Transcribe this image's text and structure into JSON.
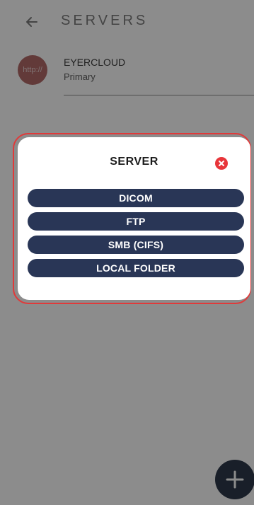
{
  "app_bar": {
    "title": "SERVERS",
    "back_icon": "arrow-left-icon"
  },
  "servers": [
    {
      "avatar_text": "http://",
      "name": "EYERCLOUD",
      "role": "Primary",
      "avatar_color": "#b36a69"
    }
  ],
  "fab": {
    "icon": "plus-icon",
    "color": "#2f3a4b"
  },
  "dialog": {
    "title": "SERVER",
    "close_icon": "close-icon",
    "close_color": "#e8353a",
    "button_color": "#293656",
    "highlight_outline_color": "#e03a3a",
    "options": [
      {
        "label": "DICOM"
      },
      {
        "label": "FTP"
      },
      {
        "label": "SMB (CIFS)"
      },
      {
        "label": "LOCAL FOLDER"
      }
    ]
  }
}
